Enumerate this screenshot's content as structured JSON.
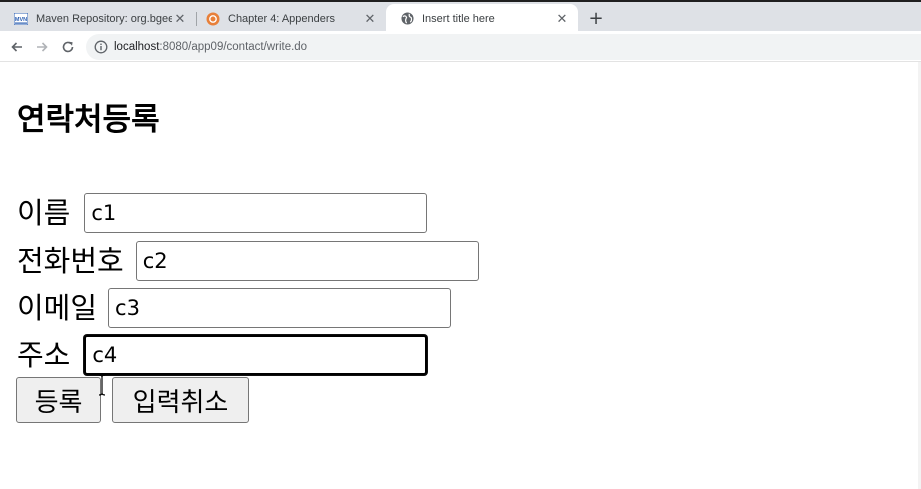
{
  "browser": {
    "tabs": [
      {
        "title": "Maven Repository: org.bgee.lo...",
        "icon": "mvn-favicon-icon",
        "active": false
      },
      {
        "title": "Chapter 4: Appenders",
        "icon": "logback-favicon-icon",
        "active": false
      },
      {
        "title": "Insert title here",
        "icon": "globe-icon",
        "active": true
      }
    ],
    "close_glyph": "✕",
    "new_tab_glyph": "+",
    "url_host": "localhost",
    "url_rest": ":8080/app09/contact/write.do",
    "favicon_text": "MVN"
  },
  "page": {
    "heading": "연락처등록",
    "fields": [
      {
        "label": "이름",
        "value": "c1"
      },
      {
        "label": "전화번호",
        "value": "c2"
      },
      {
        "label": "이메일",
        "value": "c3"
      },
      {
        "label": "주소",
        "value": "c4"
      }
    ],
    "submit_label": "등록",
    "reset_label": "입력취소"
  },
  "colors": {
    "tabstrip": "#dee1e6",
    "omnibox": "#f1f3f4",
    "button": "#efefef"
  }
}
